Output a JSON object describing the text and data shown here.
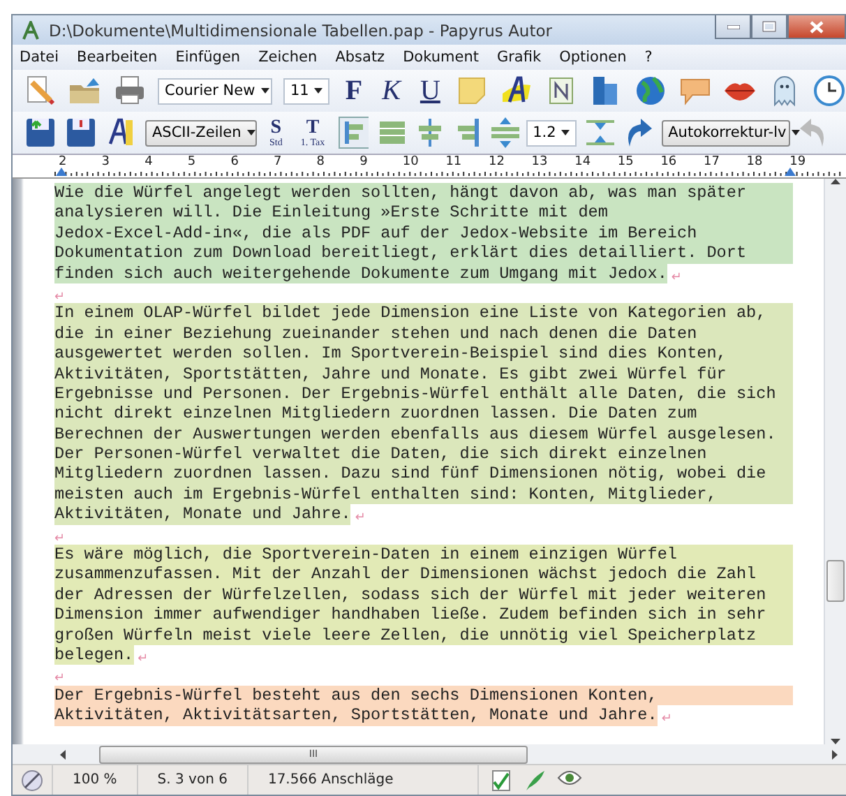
{
  "window": {
    "title": "D:\\Dokumente\\Multidimensionale Tabellen.pap - Papyrus Autor"
  },
  "menu": [
    "Datei",
    "Bearbeiten",
    "Einfügen",
    "Zeichen",
    "Absatz",
    "Dokument",
    "Grafik",
    "Optionen",
    "?"
  ],
  "toolbar_1": {
    "font": "Courier New",
    "size": "11",
    "format_buttons": [
      {
        "label": "F",
        "kind": "bold"
      },
      {
        "label": "K",
        "kind": "italic"
      },
      {
        "label": "U",
        "kind": "underline"
      }
    ]
  },
  "toolbar_2": {
    "paragraph_style": "ASCII-Zeilen",
    "style_buttons": [
      {
        "label": "S",
        "sub": "Std"
      },
      {
        "label": "T",
        "sub": "1. Tax"
      }
    ],
    "line_spacing": "1.2",
    "autocorrect": "Autokorrektur-lv"
  },
  "ruler": [
    "2",
    "3",
    "4",
    "5",
    "6",
    "7",
    "8",
    "9",
    "10",
    "11",
    "12",
    "13",
    "14",
    "15",
    "16",
    "17",
    "18",
    "19"
  ],
  "paragraphs": [
    {
      "color": "#c9e4c1",
      "end_mark": "↵",
      "lines": [
        "Wie die Würfel angelegt werden sollten, hängt davon ab, was man später",
        "analysieren will. Die Einleitung »Erste Schritte mit dem",
        "Jedox-Excel-Add-in«, die als PDF auf der Jedox-Website im Bereich",
        "Dokumentation zum Download bereitliegt, erklärt dies detailliert. Dort",
        "finden sich auch weitergehende Dokumente zum Umgang mit Jedox."
      ]
    },
    {
      "end_mark": "↵"
    },
    {
      "color": "#dbe7bb",
      "end_mark": "↵",
      "lines": [
        "In einem OLAP-Würfel bildet jede Dimension eine Liste von Kategorien ab,",
        "die in einer Beziehung zueinander stehen und nach denen die Daten",
        "ausgewertet werden sollen. Im Sportverein-Beispiel sind dies Konten,",
        "Aktivitäten, Sportstätten, Jahre und Monate. Es gibt zwei Würfel für",
        "Ergebnisse und Personen. Der Ergebnis-Würfel enthält alle Daten, die sich",
        "nicht direkt einzelnen Mitgliedern zuordnen lassen. Die Daten zum",
        "Berechnen der Auswertungen werden ebenfalls aus diesem Würfel ausgelesen.",
        "Der Personen-Würfel verwaltet die Daten, die sich direkt einzelnen",
        "Mitgliedern zuordnen lassen. Dazu sind fünf Dimensionen nötig, wobei die",
        "meisten auch im Ergebnis-Würfel enthalten sind: Konten, Mitglieder,",
        "Aktivitäten, Monate und Jahre."
      ]
    },
    {
      "end_mark": "↵"
    },
    {
      "color": "#e2eab6",
      "end_mark": "↵",
      "lines": [
        "Es wäre möglich, die Sportverein-Daten in einem einzigen Würfel",
        "zusammenzufassen. Mit der Anzahl der Dimensionen wächst jedoch die Zahl",
        "der Adressen der Würfelzellen, sodass sich der Würfel mit jeder weiteren",
        "Dimension immer aufwendiger handhaben ließe. Zudem befinden sich in sehr",
        "großen Würfeln meist viele leere Zellen, die unnötig viel Speicherplatz",
        "belegen."
      ]
    },
    {
      "end_mark": "↵"
    },
    {
      "color": "#fbd9bf",
      "end_mark": "↵",
      "lines": [
        "Der Ergebnis-Würfel besteht aus den sechs Dimensionen Konten,",
        "Aktivitäten, Aktivitätsarten, Sportstätten, Monate und Jahre."
      ]
    }
  ],
  "hscroll_grip": "III",
  "status_bar": {
    "zoom": "100 %",
    "page": "S. 3 von 6",
    "count": "17.566 Anschläge"
  }
}
